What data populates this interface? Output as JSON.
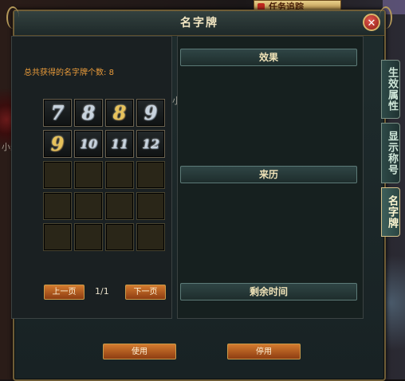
{
  "window": {
    "title": "名字牌",
    "close_glyph": "✕"
  },
  "background": {
    "quest_label": "任务追踪",
    "npc_name_1": "小姐",
    "npc_name_2": "小米"
  },
  "left_panel": {
    "count_label": "总共获得的名字牌个数:",
    "count_value": "8",
    "slots": [
      {
        "glyph": "7",
        "style": "silver"
      },
      {
        "glyph": "8",
        "style": "silver"
      },
      {
        "glyph": "8",
        "style": "gold"
      },
      {
        "glyph": "9",
        "style": "silver"
      },
      {
        "glyph": "9",
        "style": "gold"
      },
      {
        "glyph": "10",
        "style": "silver"
      },
      {
        "glyph": "11",
        "style": "silver"
      },
      {
        "glyph": "12",
        "style": "silver"
      },
      {
        "glyph": "",
        "style": "empty"
      },
      {
        "glyph": "",
        "style": "empty"
      },
      {
        "glyph": "",
        "style": "empty"
      },
      {
        "glyph": "",
        "style": "empty"
      },
      {
        "glyph": "",
        "style": "empty"
      },
      {
        "glyph": "",
        "style": "empty"
      },
      {
        "glyph": "",
        "style": "empty"
      },
      {
        "glyph": "",
        "style": "empty"
      },
      {
        "glyph": "",
        "style": "empty"
      },
      {
        "glyph": "",
        "style": "empty"
      },
      {
        "glyph": "",
        "style": "empty"
      },
      {
        "glyph": "",
        "style": "empty"
      }
    ],
    "prev_label": "上一页",
    "page": "1/1",
    "next_label": "下一页"
  },
  "right_panel": {
    "effect_header": "效果",
    "origin_header": "来历",
    "time_header": "剩余时间"
  },
  "actions": {
    "use_label": "使用",
    "disable_label": "停用"
  },
  "side_tabs": [
    {
      "label": "生效属性",
      "active": false
    },
    {
      "label": "显示称号",
      "active": false
    },
    {
      "label": "名字牌",
      "active": true
    }
  ]
}
